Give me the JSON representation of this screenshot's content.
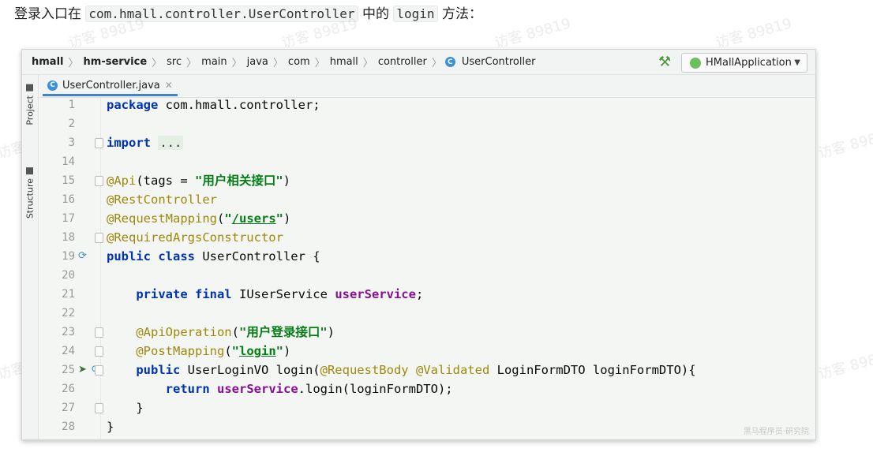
{
  "intro": {
    "prefix": "登录入口在",
    "class_path": "com.hmall.controller.UserController",
    "middle": "中的",
    "method": "login",
    "suffix": "方法："
  },
  "watermark_text": "访客 89819",
  "breadcrumb": [
    "hmall",
    "hm-service",
    "src",
    "main",
    "java",
    "com",
    "hmall",
    "controller",
    "UserController"
  ],
  "run_config": "HMallApplication",
  "sidebar": {
    "project": "Project",
    "structure": "Structure"
  },
  "tab": {
    "filename": "UserController.java"
  },
  "code_lines": [
    {
      "n": "1",
      "segs": [
        [
          "kw",
          "package"
        ],
        [
          "",
          "com.hmall.controller;"
        ]
      ]
    },
    {
      "n": "2",
      "segs": []
    },
    {
      "n": "3",
      "segs": [
        [
          "kw",
          "import"
        ],
        [
          "",
          " "
        ],
        [
          "fold",
          "..."
        ]
      ]
    },
    {
      "n": "14",
      "segs": []
    },
    {
      "n": "15",
      "segs": [
        [
          "ann",
          "@Api"
        ],
        [
          "",
          "(tags = "
        ],
        [
          "str",
          "\"用户相关接口\""
        ],
        [
          "",
          ")"
        ]
      ]
    },
    {
      "n": "16",
      "segs": [
        [
          "ann",
          "@RestController"
        ]
      ]
    },
    {
      "n": "17",
      "segs": [
        [
          "ann",
          "@RequestMapping"
        ],
        [
          "",
          "("
        ],
        [
          "str",
          "\""
        ],
        [
          "strU",
          "/users"
        ],
        [
          "str",
          "\""
        ],
        [
          "",
          ")"
        ]
      ]
    },
    {
      "n": "18",
      "segs": [
        [
          "ann",
          "@RequiredArgsConstructor"
        ]
      ]
    },
    {
      "n": "19",
      "segs": [
        [
          "kw",
          "public class"
        ],
        [
          "",
          " UserController {"
        ]
      ]
    },
    {
      "n": "20",
      "segs": []
    },
    {
      "n": "21",
      "segs": [
        [
          "",
          "    "
        ],
        [
          "kw",
          "private final"
        ],
        [
          "",
          " IUserService "
        ],
        [
          "field",
          "userService"
        ],
        [
          "",
          ";"
        ]
      ]
    },
    {
      "n": "22",
      "segs": []
    },
    {
      "n": "23",
      "segs": [
        [
          "",
          "    "
        ],
        [
          "ann",
          "@ApiOperation"
        ],
        [
          "",
          "("
        ],
        [
          "str",
          "\"用户登录接口\""
        ],
        [
          "",
          ")"
        ]
      ]
    },
    {
      "n": "24",
      "segs": [
        [
          "",
          "    "
        ],
        [
          "ann",
          "@PostMapping"
        ],
        [
          "",
          "("
        ],
        [
          "str",
          "\""
        ],
        [
          "strU",
          "login"
        ],
        [
          "str",
          "\""
        ],
        [
          "",
          ")"
        ]
      ]
    },
    {
      "n": "25",
      "segs": [
        [
          "",
          "    "
        ],
        [
          "kw",
          "public"
        ],
        [
          "",
          " UserLoginVO login("
        ],
        [
          "ann",
          "@RequestBody @Validated"
        ],
        [
          "",
          " LoginFormDTO loginFormDTO){"
        ]
      ]
    },
    {
      "n": "26",
      "segs": [
        [
          "",
          "        "
        ],
        [
          "kw",
          "return"
        ],
        [
          "",
          " "
        ],
        [
          "field",
          "userService"
        ],
        [
          "",
          ".login(loginFormDTO);"
        ]
      ]
    },
    {
      "n": "27",
      "segs": [
        [
          "",
          "    }"
        ]
      ]
    },
    {
      "n": "28",
      "segs": [
        [
          "",
          "}"
        ]
      ]
    }
  ],
  "signature": "黑马程序员·研究院"
}
